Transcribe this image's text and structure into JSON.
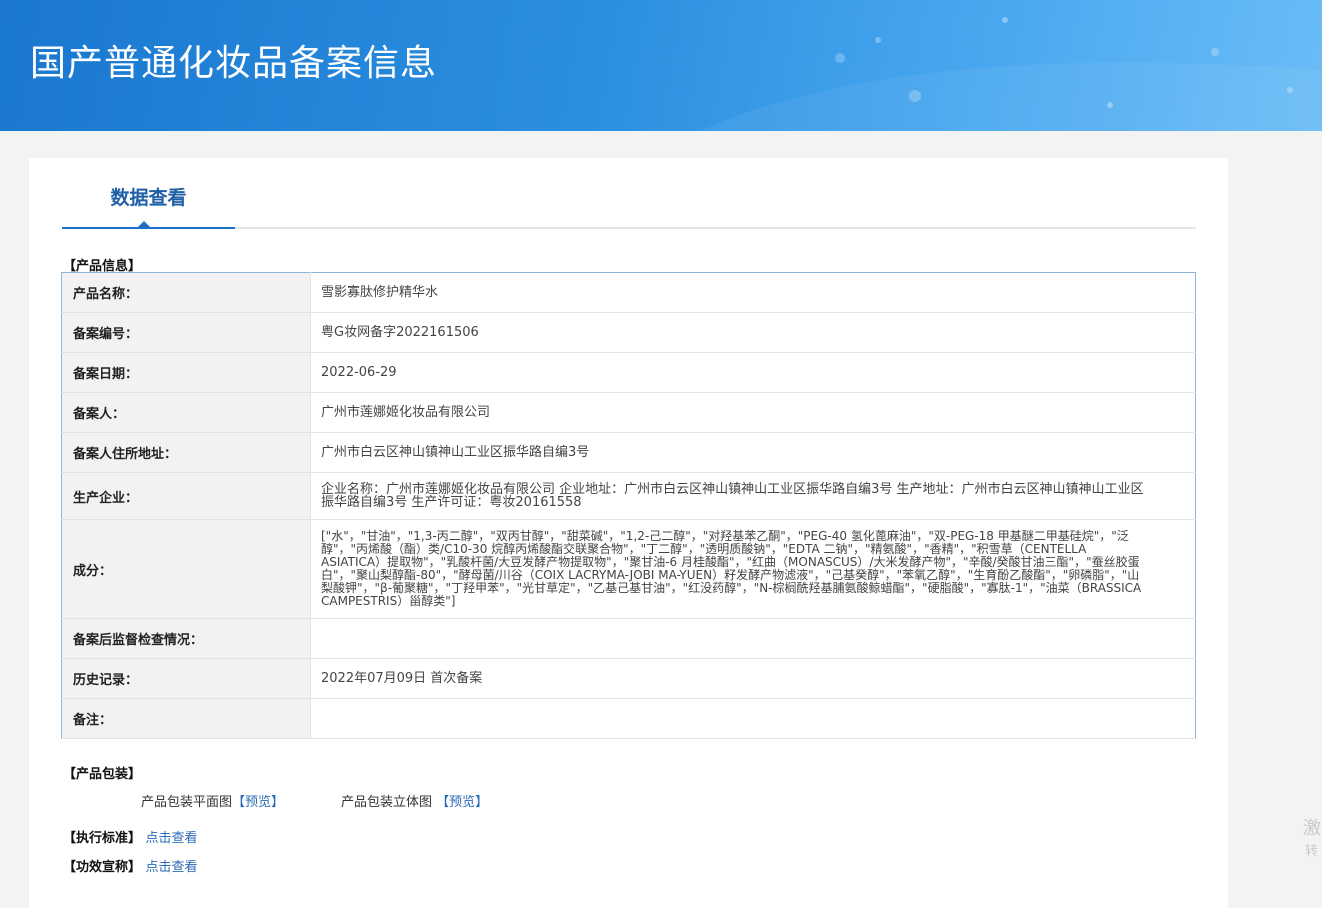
{
  "banner": {
    "title": "国产普通化妆品备案信息"
  },
  "tabs": {
    "active_label": "数据查看"
  },
  "product_info": {
    "section_title": "【产品信息】",
    "rows": [
      {
        "key": "产品名称：",
        "value": "雪影寡肽修护精华水"
      },
      {
        "key": "备案编号：",
        "value": "粤G妆网备字2022161506"
      },
      {
        "key": "备案日期：",
        "value": "2022-06-29"
      },
      {
        "key": "备案人：",
        "value": "广州市莲娜姬化妆品有限公司"
      },
      {
        "key": "备案人住所地址：",
        "value": "广州市白云区神山镇神山工业区振华路自编3号"
      },
      {
        "key": "生产企业：",
        "value": "企业名称：广州市莲娜姬化妆品有限公司 企业地址：广州市白云区神山镇神山工业区振华路自编3号 生产地址：广州市白云区神山镇神山工业区振华路自编3号 生产许可证：粤妆20161558"
      },
      {
        "key": "成分：",
        "value": "[\"水\"，\"甘油\"，\"1,3-丙二醇\"，\"双丙甘醇\"，\"甜菜碱\"，\"1,2-己二醇\"，\"对羟基苯乙酮\"，\"PEG-40 氢化蓖麻油\"，\"双-PEG-18 甲基醚二甲基硅烷\"，\"泛醇\"，\"丙烯酸（酯）类/C10-30 烷醇丙烯酸酯交联聚合物\"，\"丁二醇\"，\"透明质酸钠\"，\"EDTA 二钠\"，\"精氨酸\"，\"香精\"，\"积雪草（CENTELLA ASIATICA）提取物\"，\"乳酸杆菌/大豆发酵产物提取物\"，\"聚甘油-6 月桂酸酯\"，\"红曲（MONASCUS）/大米发酵产物\"，\"辛酸/癸酸甘油三酯\"，\"蚕丝胶蛋白\"，\"聚山梨醇酯-80\"，\"酵母菌/川谷（COIX LACRYMA-JOBI MA-YUEN）籽发酵产物滤液\"，\"己基癸醇\"，\"苯氧乙醇\"，\"生育酚乙酸酯\"，\"卵磷脂\"，\"山梨酸钾\"，\"β-葡聚糖\"，\"丁羟甲苯\"，\"光甘草定\"，\"乙基己基甘油\"，\"红没药醇\"，\"N-棕榈酰羟基脯氨酸鲸蜡酯\"，\"硬脂酸\"，\"寡肽-1\"，\"油菜（BRASSICA CAMPESTRIS）甾醇类\"]"
      },
      {
        "key": "备案后监督检查情况：",
        "value": ""
      },
      {
        "key": "历史记录：",
        "value": "2022年07月09日 首次备案"
      },
      {
        "key": "备注：",
        "value": ""
      }
    ]
  },
  "packaging": {
    "section_title": "【产品包装】",
    "flat_label": "产品包装平面图",
    "flat_link": "【预览】",
    "solid_label": "产品包装立体图",
    "solid_link": "【预览】"
  },
  "standard": {
    "label": "【执行标准】",
    "link": "点击查看"
  },
  "efficacy": {
    "label": "【功效宣称】",
    "link": "点击查看"
  },
  "side_watermark": {
    "line1": "激",
    "line2": "转"
  }
}
